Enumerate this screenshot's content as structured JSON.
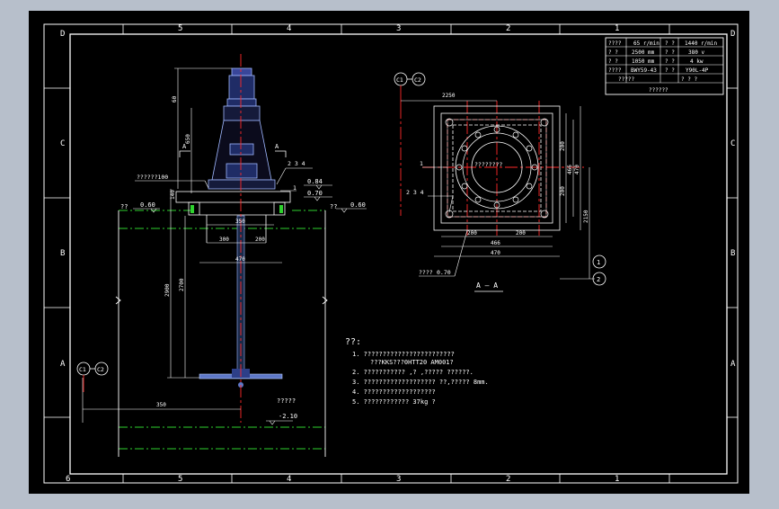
{
  "colors": {
    "background": "#000000",
    "border": "#ffffff",
    "centerline": "#ff2a2a",
    "ground": "#2ed12e",
    "dimension": "#ffffff",
    "accent": "#e8e84a"
  },
  "frame": {
    "columns": [
      "6",
      "5",
      "4",
      "3",
      "2",
      "1"
    ],
    "rows": [
      "D",
      "C",
      "B",
      "A"
    ]
  },
  "title_block": {
    "row1": [
      "????",
      "65 r/min",
      "? ?",
      "1440 r/min"
    ],
    "row2": [
      "? ?",
      "2500 mm",
      "? ?",
      "380 v"
    ],
    "row3": [
      "? ?",
      "1050 mm",
      "? ?",
      "4 kw"
    ],
    "row4": [
      "????",
      "BWY59-43",
      "? ?",
      "Y90L-4P"
    ],
    "row5": [
      "?????",
      "? ? ?"
    ],
    "row6": [
      "??????"
    ]
  },
  "elevation": {
    "section_mark_left": "A",
    "section_mark_right": "A",
    "flange_label": "??????100",
    "parts_label": "2 3 4",
    "part1": "1",
    "dim_top": "60",
    "dim_650": "650",
    "dim_140": "140",
    "dim_350": "350",
    "dim_300": "300",
    "dim_200": "200",
    "dim_470": "470",
    "dim_2700": "2700",
    "dim_2900": "2900",
    "dim_350_bottom": "350",
    "level_084": "0.84",
    "level_070": "0.70",
    "level_060_left": "0.60",
    "level_060_right": "0.60",
    "level_left_q": "??",
    "level_right_q": "??",
    "level_bottom": "-2.10",
    "bottom_note": "?????",
    "ref_c1": "C1",
    "ref_c2": "C2"
  },
  "plan": {
    "ref_c1": "C1",
    "ref_c2": "C2",
    "dim_2250": "2250",
    "center_label": "????????",
    "part1": "1",
    "parts_label": "2 3 4",
    "dim_200a": "200",
    "dim_200b": "200",
    "dim_466": "466",
    "dim_470": "470",
    "dim_v200a": "200",
    "dim_v200b": "200",
    "dim_v466": "466",
    "dim_v470": "470",
    "dim_2150": "2150",
    "bottom_note": "????",
    "bottom_level": "0.70",
    "section_title": "A — A",
    "circle_1": "1",
    "circle_2": "2"
  },
  "notes": {
    "heading": "??:",
    "line1": "1. ????????????????????????",
    "line1b": "???KKS???0HTT20 AM001?",
    "line2": "2. ??????????? ,? ,????? ??????.",
    "line3": "3. ???????????????????      ??,????? 8mm.",
    "line4": "4. ???????????????????",
    "line5": "5. ????????????    37kg ?"
  }
}
